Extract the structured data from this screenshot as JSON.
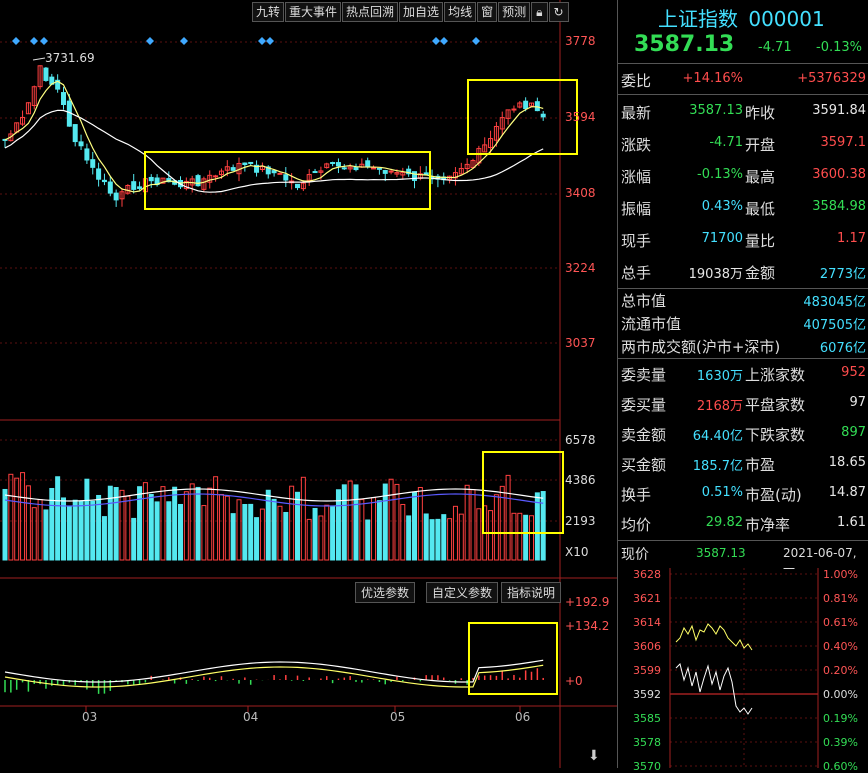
{
  "toolbar": {
    "items": [
      "九转",
      "重大事件",
      "热点回溯",
      "加自选",
      "均线",
      "窗",
      "预测"
    ],
    "lock_icon": "lock-icon",
    "refresh_icon": "refresh-icon"
  },
  "main_chart": {
    "price_axis": [
      "3778",
      "3594",
      "3408",
      "3224",
      "3037"
    ],
    "high_label": "3731.69",
    "volume_axis": [
      "6578",
      "4386",
      "2193",
      "X10"
    ],
    "indicator_axis": [
      "+192.9",
      "+134.2",
      "+0"
    ],
    "months": [
      "03",
      "04",
      "05",
      "06"
    ],
    "indicator_tabs": [
      "优选参数",
      "自定义参数",
      "指标说明"
    ],
    "colors": {
      "up": "#ff4040",
      "down": "#54e8f0",
      "ma5": "#ffff80",
      "ma10": "#ffffff",
      "ma20": "#ffff00",
      "ma30": "#5a5aff",
      "highlight": "#ffff00"
    }
  },
  "quote": {
    "name": "上证指数",
    "code": "000001",
    "price": "3587.13",
    "change": "-4.71",
    "change_pct": "-0.13%"
  },
  "stats": [
    {
      "l": "委比",
      "v1": "+14.16%",
      "v1c": "red",
      "l2": "",
      "v2": "+5376329",
      "v2c": "red"
    },
    {
      "l": "最新",
      "v1": "3587.13",
      "v1c": "green",
      "l2": "昨收",
      "v2": "3591.84",
      "v2c": "white"
    },
    {
      "l": "涨跌",
      "v1": "-4.71",
      "v1c": "green",
      "l2": "开盘",
      "v2": "3597.1",
      "v2c": "red"
    },
    {
      "l": "涨幅",
      "v1": "-0.13%",
      "v1c": "green",
      "l2": "最高",
      "v2": "3600.38",
      "v2c": "red"
    },
    {
      "l": "振幅",
      "v1": "0.43%",
      "v1c": "cyan",
      "l2": "最低",
      "v2": "3584.98",
      "v2c": "green"
    },
    {
      "l": "现手",
      "v1": "71700",
      "v1c": "cyan",
      "l2": "量比",
      "v2": "1.17",
      "v2c": "red"
    },
    {
      "l": "总手",
      "v1": "19038万",
      "v1c": "white",
      "l2": "金额",
      "v2": "2773亿",
      "v2c": "cyan"
    }
  ],
  "market": [
    {
      "l": "总市值",
      "v": "483045亿"
    },
    {
      "l": "流通市值",
      "v": "407505亿"
    },
    {
      "l": "两市成交额(沪市+深市)",
      "v": "6076亿"
    }
  ],
  "stats2": [
    {
      "l": "委卖量",
      "v1": "1630万",
      "v1c": "cyan",
      "l2": "上涨家数",
      "v2": "952",
      "v2c": "red"
    },
    {
      "l": "委买量",
      "v1": "2168万",
      "v1c": "red",
      "l2": "平盘家数",
      "v2": "97",
      "v2c": "white"
    },
    {
      "l": "卖金额",
      "v1": "64.40亿",
      "v1c": "cyan",
      "l2": "下跌家数",
      "v2": "897",
      "v2c": "green"
    },
    {
      "l": "买金额",
      "v1": "185.7亿",
      "v1c": "cyan",
      "l2": "市盈",
      "v2": "18.65",
      "v2c": "white"
    },
    {
      "l": "换手",
      "v1": "0.51%",
      "v1c": "cyan",
      "l2": "市盈(动)",
      "v2": "14.87",
      "v2c": "white"
    },
    {
      "l": "均价",
      "v1": "29.82",
      "v1c": "green",
      "l2": "市净率",
      "v2": "1.61",
      "v2c": "white"
    }
  ],
  "mini": {
    "label": "现价",
    "price": "3587.13",
    "date": "2021-06-07,一",
    "left_axis": [
      "3628",
      "3621",
      "3614",
      "3606",
      "3599",
      "3592",
      "3585",
      "3578",
      "3570"
    ],
    "right_axis": [
      "1.00%",
      "0.81%",
      "0.61%",
      "0.40%",
      "0.20%",
      "0.00%",
      "0.19%",
      "0.39%",
      "0.60%"
    ]
  }
}
